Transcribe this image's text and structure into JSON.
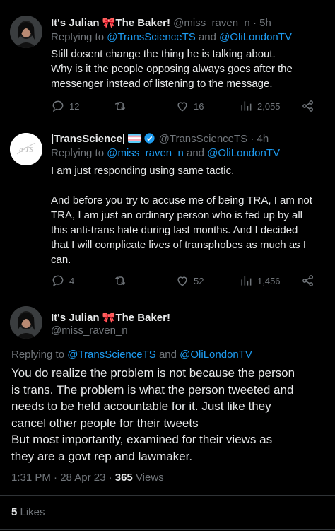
{
  "tweet1": {
    "name": "It's Julian",
    "name_emoji": "🎀",
    "name_suffix": "The Baker!",
    "handle": "@miss_raven_n",
    "time": "· 5h",
    "reply_prefix": "Replying to",
    "reply_user1": "@TransScienceTS",
    "reply_and": "and",
    "reply_user2": "@OliLondonTV",
    "text": "Still dosent change the thing he is talking about.\nWhy is it the people opposing always goes after the\nmessenger instead of listening to the message.",
    "replies": "12",
    "retweets": "",
    "likes": "16",
    "views": "2,055"
  },
  "tweet2": {
    "name": "|TransScience|",
    "handle": "@TransScienceTS",
    "time": "· 4h",
    "reply_prefix": "Replying to",
    "reply_user1": "@miss_raven_n",
    "reply_and": "and",
    "reply_user2": "@OliLondonTV",
    "text": "I am just responding using same tactic.\n\nAnd before you try to accuse me of being TRA, I am not\nTRA, I am just an ordinary person who is fed up by all\nthis anti-trans hate during last months. And I decided\nthat I will complicate lives of transphobes as much as I\ncan.",
    "replies": "4",
    "retweets": "",
    "likes": "52",
    "views": "1,456"
  },
  "main_tweet": {
    "name": "It's Julian",
    "name_emoji": "🎀",
    "name_suffix": "The Baker!",
    "handle": "@miss_raven_n",
    "reply_prefix": "Replying to",
    "reply_user1": "@TransScienceTS",
    "reply_and": "and",
    "reply_user2": "@OliLondonTV",
    "text": "You do realize the problem is not because the person\nis trans. The problem is what the person tweeted and\nneeds to be held accountable for it. Just like they\ncancel other people for their tweets\nBut most importantly, examined for their views as\nthey are a govt rep and lawmaker.",
    "timestamp": "1:31 PM · 28 Apr 23 · ",
    "views_count": "365",
    "views_label": " Views",
    "likes_count": "5",
    "likes_label": " Likes"
  },
  "colors": {
    "background": "#000000",
    "text": "#e7e9ea",
    "secondary": "#71767b",
    "link": "#1d9bf0",
    "divider": "#2f3336"
  },
  "icons": [
    "reply-icon",
    "retweet-icon",
    "like-icon",
    "views-icon",
    "share-icon",
    "verified-badge-icon",
    "trans-flag-icon",
    "ribbon-icon"
  ]
}
